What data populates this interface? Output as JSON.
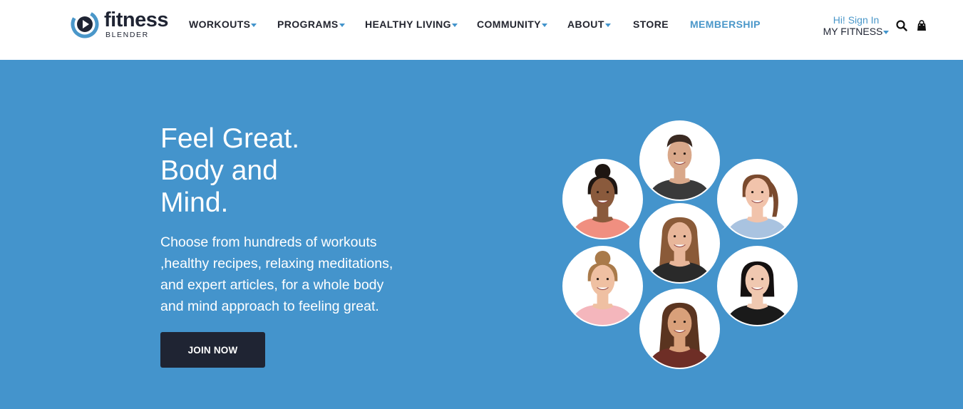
{
  "brand": {
    "name": "fitness",
    "sub": "BLENDER"
  },
  "nav": [
    {
      "label": "WORKOUTS",
      "dropdown": true
    },
    {
      "label": "PROGRAMS",
      "dropdown": true
    },
    {
      "label": "HEALTHY LIVING",
      "dropdown": true
    },
    {
      "label": "COMMUNITY",
      "dropdown": true
    },
    {
      "label": "ABOUT",
      "dropdown": true
    },
    {
      "label": "STORE",
      "dropdown": false
    },
    {
      "label": "MEMBERSHIP",
      "dropdown": false
    }
  ],
  "account": {
    "greeting": "Hi! Sign In",
    "menu_label": "MY FITNESS"
  },
  "icons": {
    "search": "search-icon",
    "cart": "shopping-bag-icon",
    "logo": "play-swirl-logo-icon",
    "caret": "caret-down-icon"
  },
  "hero": {
    "headline_lines": [
      "Feel Great.",
      "Body and",
      "Mind."
    ],
    "body": "Choose from hundreds of workouts ,healthy recipes, relaxing meditations, and expert articles, for a whole body and mind approach to feeling great.",
    "cta_label": "JOIN NOW"
  },
  "trainers": [
    {
      "hair": "#3a2a22",
      "skin": "#d9a88a",
      "top": "#3a3a3a",
      "style": "short"
    },
    {
      "hair": "#1e1612",
      "skin": "#8a5a3c",
      "top": "#f08f80",
      "style": "bun"
    },
    {
      "hair": "#7a4a2e",
      "skin": "#f1c3ab",
      "top": "#a9c3e0",
      "style": "pony"
    },
    {
      "hair": "#8a5a38",
      "skin": "#e8b69a",
      "top": "#2a2a2a",
      "style": "long"
    },
    {
      "hair": "#a97a4a",
      "skin": "#efc0a2",
      "top": "#f4b6bc",
      "style": "bun"
    },
    {
      "hair": "#141010",
      "skin": "#f0c8b0",
      "top": "#1a1a1a",
      "style": "bob"
    },
    {
      "hair": "#5a3420",
      "skin": "#d9a07a",
      "top": "#6e2e26",
      "style": "long"
    }
  ],
  "colors": {
    "accent": "#4494cc",
    "dark": "#1f2433",
    "link": "#4a97c9"
  }
}
